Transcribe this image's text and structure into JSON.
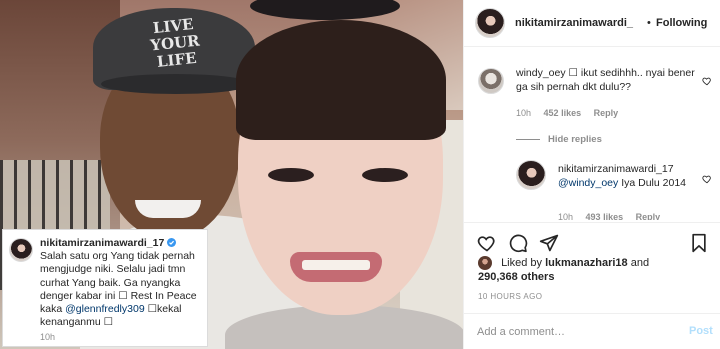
{
  "post": {
    "author": "nikitamirzanimawardi_",
    "follow_separator": "•",
    "follow_label": "Following",
    "image_cap_text": "LIVE YOUR LIFE"
  },
  "caption": {
    "username": "nikitamirzanimawardi_17",
    "verified_icon": "verified-badge-icon",
    "text_1": "Salah satu org Yang tidak pernah mengjudge niki. Selalu jadi tmn curhat Yang baik. Ga nyangka denger kabar ini",
    "text_2": "Rest In Peace kaka",
    "mention": "@glennfredly309",
    "text_3": "kekal kenanganmu",
    "time": "10h"
  },
  "comments": [
    {
      "username": "windy_oey",
      "text": "ikut sedihhh.. nyai bener ga sih pernah dkt dulu??",
      "time": "10h",
      "likes": "452 likes",
      "reply_label": "Reply"
    }
  ],
  "hide_replies_label": "Hide replies",
  "reply": {
    "username": "nikitamirzanimawardi_17",
    "mention": "@windy_oey",
    "text": "Iya Dulu 2014",
    "time": "10h",
    "likes": "493 likes",
    "reply_label": "Reply"
  },
  "liked_by": {
    "prefix": "Liked by",
    "user": "lukmanazhari18",
    "joiner": "and",
    "others": "290,368 others"
  },
  "post_time": "10 HOURS AGO",
  "add_comment": {
    "placeholder": "Add a comment…",
    "post_label": "Post"
  },
  "colors": {
    "link": "#00376b",
    "muted": "#8e8e8e",
    "post_button": "#b2dffc",
    "border": "#efefef"
  }
}
